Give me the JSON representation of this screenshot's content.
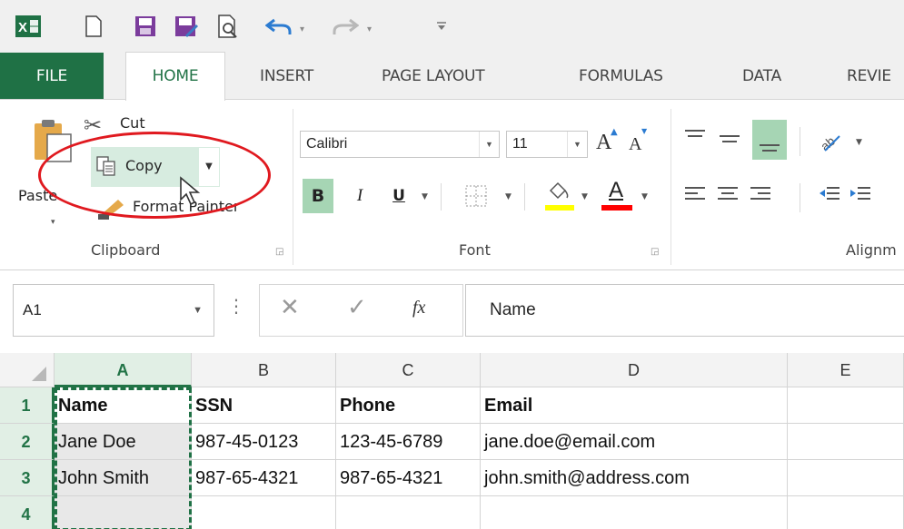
{
  "quick_access": {
    "icons": [
      "excel-logo-icon",
      "new-document-icon",
      "save-icon",
      "save-as-icon",
      "print-preview-icon",
      "undo-icon",
      "redo-icon",
      "customize-toolbar-icon"
    ]
  },
  "tabs": [
    "FILE",
    "HOME",
    "INSERT",
    "PAGE LAYOUT",
    "FORMULAS",
    "DATA",
    "REVIE"
  ],
  "active_tab": "HOME",
  "ribbon": {
    "clipboard": {
      "paste_label": "Paste",
      "cut_label": "Cut",
      "copy_label": "Copy",
      "format_painter_label": "Format Painter",
      "group_label": "Clipboard"
    },
    "font": {
      "font_name": "Calibri",
      "font_size": "11",
      "bold_label": "B",
      "italic_label": "I",
      "underline_label": "U",
      "font_color_label": "A",
      "grow_label": "A",
      "shrink_label": "A",
      "group_label": "Font"
    },
    "alignment": {
      "group_label": "Alignm"
    }
  },
  "formula_bar": {
    "name_box": "A1",
    "fx_label": "fx",
    "formula_value": "Name"
  },
  "sheet": {
    "columns": [
      "A",
      "B",
      "C",
      "D",
      "E"
    ],
    "rows": [
      "1",
      "2",
      "3",
      "4"
    ],
    "cells": [
      [
        "Name",
        "SSN",
        "Phone",
        "Email",
        ""
      ],
      [
        "Jane Doe",
        "987-45-0123",
        "123-45-6789",
        "jane.doe@email.com",
        ""
      ],
      [
        "John Smith",
        "987-65-4321",
        "987-65-4321",
        "john.smith@address.com",
        ""
      ],
      [
        "",
        "",
        "",
        "",
        ""
      ]
    ],
    "selected_column": "A"
  },
  "colors": {
    "excel_green": "#217346",
    "file_tab": "#1f7145",
    "highlight_yellow": "#ffff00",
    "font_color_red": "#ff0000",
    "annotation_red": "#e0191f"
  }
}
